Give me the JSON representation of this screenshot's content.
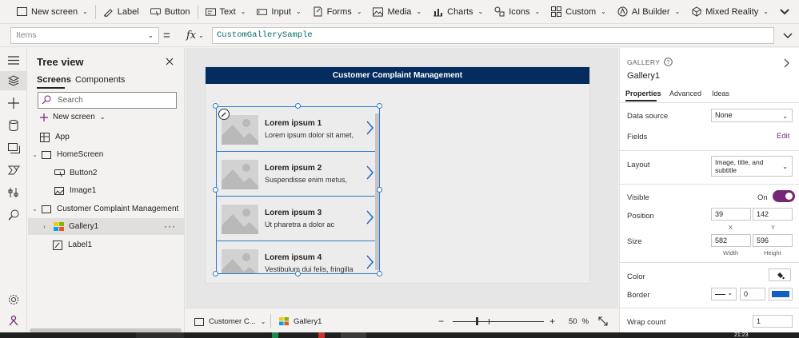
{
  "toolbar": {
    "items": [
      {
        "label": "New screen",
        "icon": "new-screen-icon"
      },
      {
        "label": "Label",
        "icon": "label-icon"
      },
      {
        "label": "Button",
        "icon": "button-icon"
      },
      {
        "label": "Text",
        "icon": "text-icon"
      },
      {
        "label": "Input",
        "icon": "input-icon"
      },
      {
        "label": "Forms",
        "icon": "forms-icon"
      },
      {
        "label": "Media",
        "icon": "media-icon"
      },
      {
        "label": "Charts",
        "icon": "charts-icon"
      },
      {
        "label": "Icons",
        "icon": "icons-icon"
      },
      {
        "label": "Custom",
        "icon": "custom-icon"
      },
      {
        "label": "AI Builder",
        "icon": "ai-builder-icon"
      },
      {
        "label": "Mixed Reality",
        "icon": "mixed-reality-icon"
      }
    ]
  },
  "formula_bar": {
    "property": "Items",
    "fx": "fx",
    "formula": "CustomGallerySample"
  },
  "tree_view": {
    "title": "Tree view",
    "tabs": [
      "Screens",
      "Components"
    ],
    "search_placeholder": "Search",
    "new_screen": "New screen",
    "nodes": {
      "app": "App",
      "home_screen": "HomeScreen",
      "button2": "Button2",
      "image1": "Image1",
      "ccm_screen": "Customer Complaint Management",
      "gallery1": "Gallery1",
      "label1": "Label1"
    }
  },
  "canvas": {
    "header_title": "Customer Complaint Management",
    "gallery_items": [
      {
        "title": "Lorem ipsum 1",
        "subtitle": "Lorem ipsum dolor sit amet,"
      },
      {
        "title": "Lorem ipsum 2",
        "subtitle": "Suspendisse enim metus,"
      },
      {
        "title": "Lorem ipsum 3",
        "subtitle": "Ut pharetra a dolor ac"
      },
      {
        "title": "Lorem ipsum 4",
        "subtitle": "Vestibulum dui felis, fringilla"
      }
    ]
  },
  "status_bar": {
    "screen_name": "Customer C...",
    "control_name": "Gallery1",
    "zoom_value": "50",
    "zoom_unit": "%",
    "zoom_minus": "−",
    "zoom_plus": "+"
  },
  "properties": {
    "type": "GALLERY",
    "name": "Gallery1",
    "tabs": [
      "Properties",
      "Advanced",
      "Ideas"
    ],
    "data_source_label": "Data source",
    "data_source_value": "None",
    "fields_label": "Fields",
    "fields_edit": "Edit",
    "layout_label": "Layout",
    "layout_value": "Image, title, and subtitle",
    "visible_label": "Visible",
    "visible_state": "On",
    "position_label": "Position",
    "position_x": "39",
    "position_y": "142",
    "x_label": "X",
    "y_label": "Y",
    "size_label": "Size",
    "size_width": "582",
    "size_height": "596",
    "width_label": "Width",
    "height_label": "Height",
    "color_label": "Color",
    "border_label": "Border",
    "border_width": "0",
    "border_color": "#0f5fc4",
    "wrap_count_label": "Wrap count",
    "wrap_count_value": "1"
  },
  "taskbar": {
    "time": "21:23"
  },
  "colors": {
    "header_bg": "#042c5e",
    "accent": "#742774",
    "selection": "#2e7bcf"
  }
}
